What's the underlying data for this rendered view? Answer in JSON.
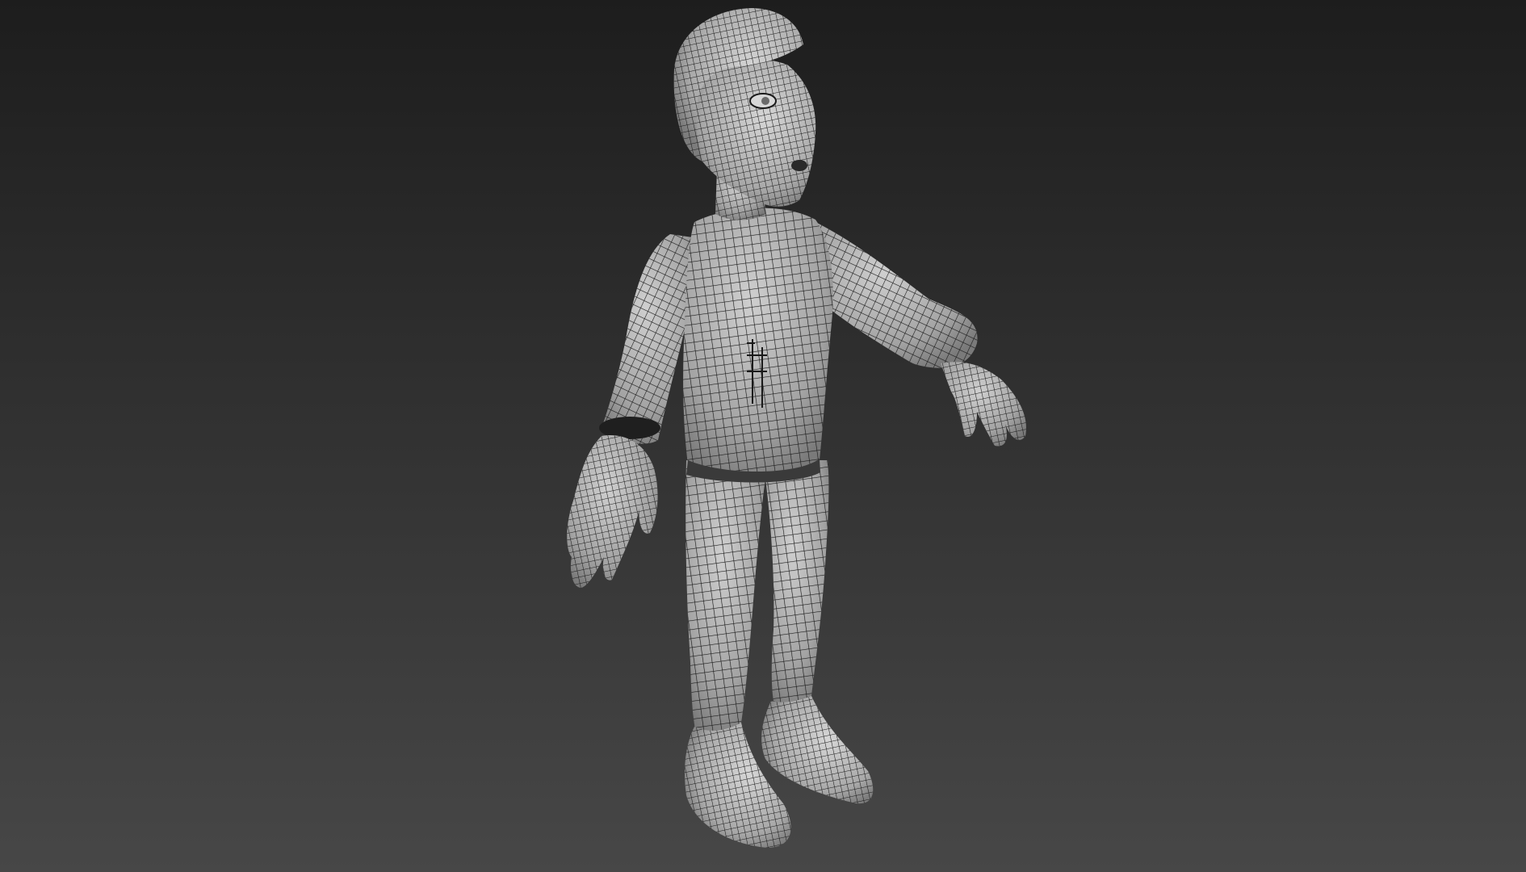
{
  "viewport": {
    "background_top": "#1d1d1d",
    "background_bottom": "#474747",
    "mesh_fill": "#9e9e9e",
    "mesh_fill_light": "#c2c2c2",
    "wire_color": "#1a1a1a",
    "display_mode": "wireframe-on-shaded"
  },
  "model": {
    "parts": [
      "hair",
      "head",
      "neck",
      "torso",
      "left-arm",
      "left-hand",
      "right-arm",
      "right-hand",
      "left-leg",
      "right-leg",
      "left-shoe",
      "right-shoe"
    ]
  }
}
